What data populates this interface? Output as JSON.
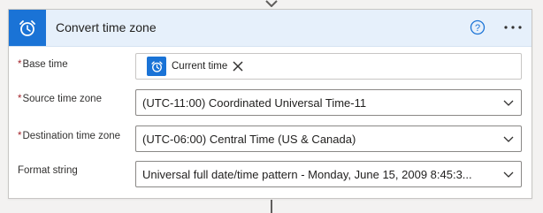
{
  "action": {
    "title": "Convert time zone",
    "icon": "alarm-clock-icon",
    "accent_color": "#1a73d6",
    "header_bg": "#e6f0fb"
  },
  "fields": {
    "base_time": {
      "label": "Base time",
      "required": "*",
      "token_label": "Current time",
      "token_icon": "alarm-clock-icon"
    },
    "source_time_zone": {
      "label": "Source time zone",
      "required": "*",
      "value": "(UTC-11:00) Coordinated Universal Time-11"
    },
    "destination_time_zone": {
      "label": "Destination time zone",
      "required": "*",
      "value": "(UTC-06:00) Central Time (US & Canada)"
    },
    "format_string": {
      "label": "Format string",
      "value": "Universal full date/time pattern - Monday, June 15, 2009 8:45:3..."
    }
  },
  "colors": {
    "required": "#a4262c",
    "border": "#8a8886"
  }
}
